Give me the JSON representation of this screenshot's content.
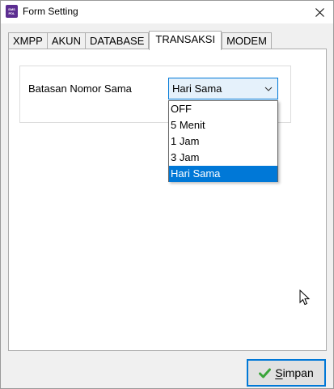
{
  "window": {
    "title": "Form Setting",
    "app_icon_text": "SMS PDL"
  },
  "tabs": [
    {
      "label": "XMPP",
      "active": false
    },
    {
      "label": "AKUN",
      "active": false
    },
    {
      "label": "DATABASE",
      "active": false
    },
    {
      "label": "TRANSAKSI",
      "active": true
    },
    {
      "label": "MODEM",
      "active": false
    }
  ],
  "transaksi": {
    "field_label": "Batasan Nomor Sama",
    "combo_value": "Hari Sama",
    "options": [
      "OFF",
      "5 Menit",
      "1 Jam",
      "3 Jam",
      "Hari Sama"
    ],
    "selected_index": 4
  },
  "buttons": {
    "save_label": "Simpan",
    "save_accesskey": "S"
  },
  "colors": {
    "accent": "#0078d7",
    "check_green": "#3aa53a",
    "app_icon": "#5c2d91"
  }
}
